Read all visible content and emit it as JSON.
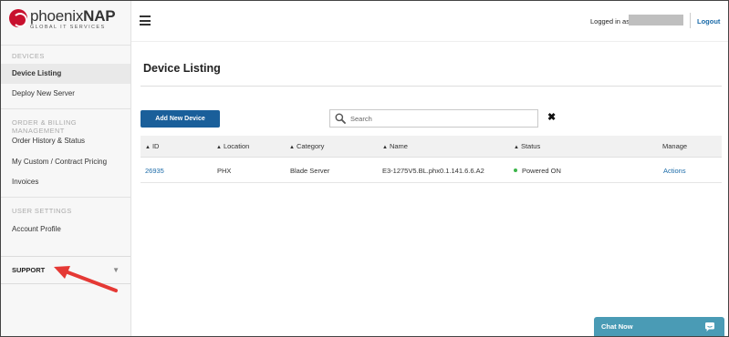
{
  "brand": {
    "name_light": "phoenix",
    "name_bold": "NAP",
    "tagline": "GLOBAL IT SERVICES"
  },
  "sidebar": {
    "sections": [
      {
        "heading": "DEVICES",
        "items": [
          "Device Listing",
          "Deploy New Server"
        ]
      },
      {
        "heading": "ORDER & BILLING MANAGEMENT",
        "items": [
          "Order History & Status",
          "My Custom / Contract Pricing",
          "Invoices"
        ]
      },
      {
        "heading": "USER SETTINGS",
        "items": [
          "Account Profile"
        ]
      }
    ],
    "active_item": "Device Listing",
    "support_label": "SUPPORT",
    "support_caret": "▼"
  },
  "header": {
    "logged_in_prefix": "Logged in as",
    "logout_label": "Logout"
  },
  "main": {
    "title": "Device Listing",
    "add_button_label": "Add New Device",
    "search_placeholder": "Search",
    "clear_symbol": "✖"
  },
  "table": {
    "columns": [
      "ID",
      "Location",
      "Category",
      "Name",
      "Status",
      "Manage"
    ],
    "rows": [
      {
        "id": "26935",
        "location": "PHX",
        "category": "Blade Server",
        "name": "E3-1275V5.BL.phx0.1.141.6.6.A2",
        "status": "Powered ON",
        "manage": "Actions"
      }
    ],
    "status_color": "#3cb54a"
  },
  "chat": {
    "label": "Chat Now"
  },
  "colors": {
    "accent": "#1a5f9a",
    "link": "#1a6aa8",
    "brand_red": "#c8102e",
    "chat": "#4a9bb5",
    "annotation_arrow": "#e53935"
  }
}
